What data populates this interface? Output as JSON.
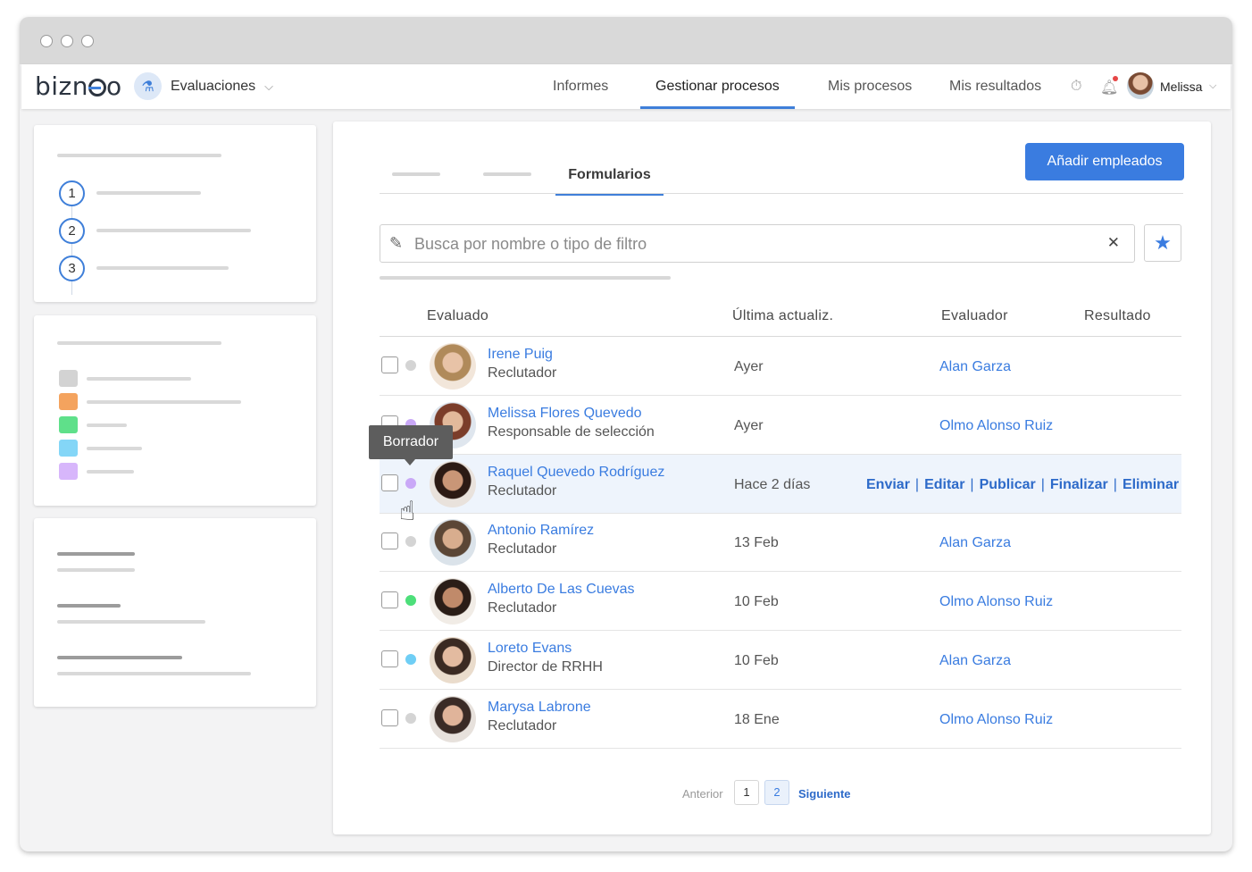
{
  "app": {
    "logo": "bizneo",
    "module": "Evaluaciones"
  },
  "nav": {
    "tabs": [
      "Informes",
      "Gestionar procesos",
      "Mis procesos",
      "Mis resultados"
    ],
    "active_tab": "Gestionar procesos",
    "user_name": "Melissa"
  },
  "sidebar": {
    "steps": [
      "1",
      "2",
      "3"
    ],
    "swatch_colors": [
      "#d3d3d3",
      "#f4a35e",
      "#5fe08a",
      "#84d6f7",
      "#d7b6fb"
    ]
  },
  "main": {
    "subtab_active": "Formularios",
    "add_button": "Añadir empleados",
    "search_placeholder": "Busca por nombre o tipo de filtro",
    "columns": [
      "Evaluado",
      "Última actualiz.",
      "Evaluador",
      "Resultado"
    ],
    "tooltip": "Borrador",
    "actions": [
      "Enviar",
      "Editar",
      "Publicar",
      "Finalizar",
      "Eliminar"
    ],
    "rows": [
      {
        "name": "Irene Puig",
        "role": "Reclutador",
        "date": "Ayer",
        "evaluator": "Alan Garza",
        "status_color": "#d4d4d4"
      },
      {
        "name": "Melissa Flores Quevedo",
        "role": "Responsable de selección",
        "date": "Ayer",
        "evaluator": "Olmo Alonso Ruiz",
        "status_color": "#c9a8f7"
      },
      {
        "name": "Raquel Quevedo Rodríguez",
        "role": "Reclutador",
        "date": "Hace 2 días",
        "evaluator": "",
        "status_color": "#c9a8f7"
      },
      {
        "name": "Antonio Ramírez",
        "role": "Reclutador",
        "date": "13 Feb",
        "evaluator": "Alan Garza",
        "status_color": "#d4d4d4"
      },
      {
        "name": "Alberto De Las Cuevas",
        "role": "Reclutador",
        "date": "10 Feb",
        "evaluator": "Olmo Alonso Ruiz",
        "status_color": "#4ddf7a"
      },
      {
        "name": "Loreto Evans",
        "role": "Director de RRHH",
        "date": "10 Feb",
        "evaluator": "Alan Garza",
        "status_color": "#6fcef5"
      },
      {
        "name": "Marysa Labrone",
        "role": "Reclutador",
        "date": "18 Ene",
        "evaluator": "Olmo Alonso Ruiz",
        "status_color": "#d4d4d4"
      }
    ],
    "pagination": {
      "prev": "Anterior",
      "pages": [
        "1",
        "2"
      ],
      "active_page": "2",
      "next": "Siguiente"
    }
  },
  "accent_color": "#3a7ce0"
}
